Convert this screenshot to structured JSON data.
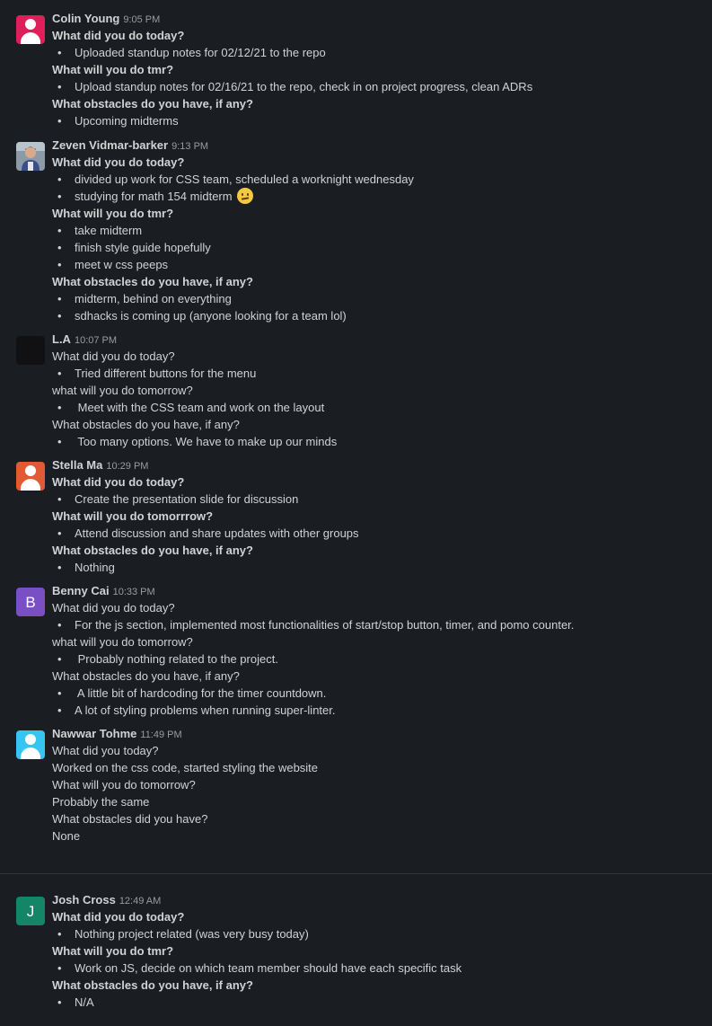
{
  "colors": {
    "background": "#1a1d21",
    "text": "#d1d2d3",
    "timestamp": "#9b9c9e",
    "avatar_colin": "#e01e5a",
    "avatar_stella": "#e05a34",
    "avatar_benny": "#7b4fc4",
    "avatar_nawwar": "#36c5f0",
    "avatar_josh": "#148567"
  },
  "messages": [
    {
      "name": "Colin Young",
      "time": "9:05 PM",
      "avatar_icon": "default-person-icon",
      "lines": [
        "What did you do today?",
        "Uploaded standup notes for 02/12/21 to the repo",
        "What will you do tmr?",
        "Upload standup notes for 02/16/21 to the repo, check in on project progress, clean ADRs",
        "What obstacles do you have, if any?",
        "Upcoming midterms"
      ]
    },
    {
      "name": "Zeven Vidmar-barker",
      "time": "9:13 PM",
      "avatar_icon": "photo-avatar",
      "lines": [
        "What did you do today?",
        "divided up work for CSS team, scheduled a worknight wednesday",
        "studying for math 154 midterm",
        "What will you do tmr?",
        "take midterm",
        "finish style guide hopefully",
        "meet w css peeps",
        "What obstacles do you have, if any?",
        "midterm, behind on everything",
        "sdhacks is coming up (anyone looking for a team lol)"
      ],
      "emoji": "slightly-frowning-face-icon"
    },
    {
      "name": "L.A",
      "time": "10:07 PM",
      "avatar_icon": "dark-photo-avatar",
      "lines": [
        "What did you do today?",
        "Tried different buttons for the menu",
        "what will you do tomorrow?",
        "Meet with the CSS team and work on the layout",
        "What obstacles do you have, if any?",
        "Too many options. We have to make up our minds"
      ]
    },
    {
      "name": "Stella Ma",
      "time": "10:29 PM",
      "avatar_icon": "default-person-icon",
      "lines": [
        "What did you do today?",
        "Create the presentation slide for discussion",
        "What will you do tomorrrow?",
        "Attend discussion and share updates with other groups",
        "What obstacles do you have, if any?",
        "Nothing"
      ]
    },
    {
      "name": "Benny Cai",
      "time": "10:33 PM",
      "avatar_letter": "B",
      "lines": [
        "What did you do today?",
        "For the js section, implemented most functionalities of start/stop button, timer, and pomo counter.",
        "what will you do tomorrow?",
        "Probably nothing related to the project.",
        "What obstacles do you have, if any?",
        "A little bit of hardcoding for the timer countdown.",
        "A lot of styling problems when running super-linter."
      ]
    },
    {
      "name": "Nawwar Tohme",
      "time": "11:49 PM",
      "avatar_icon": "default-person-icon",
      "lines": [
        "What did you today?",
        "Worked on the css code, started styling the website",
        "What will you do tomorrow?",
        "Probably the same",
        "What obstacles did you have?",
        "None"
      ]
    },
    {
      "name": "Josh Cross",
      "time": "12:49 AM",
      "avatar_letter": "J",
      "lines": [
        "What did you do today?",
        "Nothing project related (was very busy today)",
        "What will you do tmr?",
        "Work on JS, decide on which team member should have each specific task",
        "What obstacles do you have, if any?",
        "N/A"
      ]
    }
  ]
}
